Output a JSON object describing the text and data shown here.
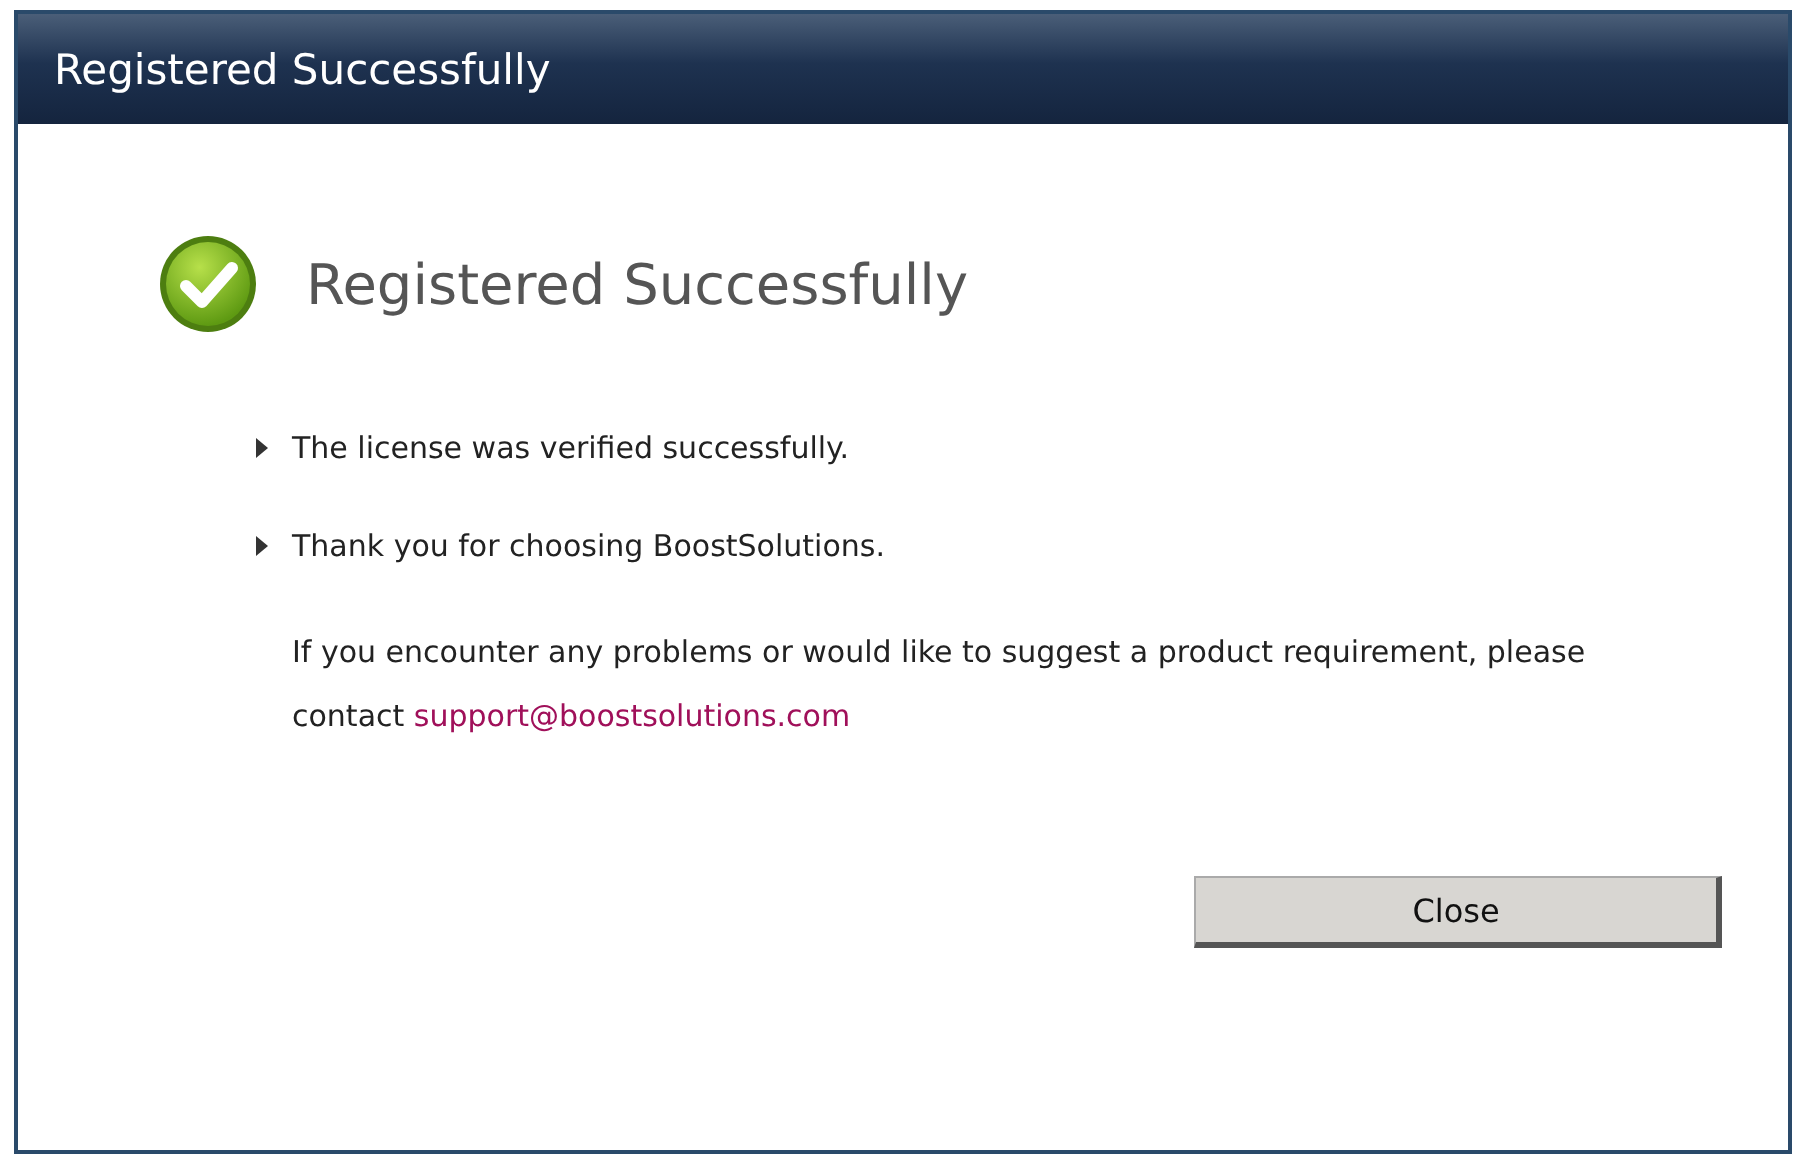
{
  "window": {
    "title": "Registered Successfully"
  },
  "heading": "Registered Successfully",
  "bullets": [
    "The license was verified successfully.",
    "Thank you for choosing BoostSolutions."
  ],
  "contact": {
    "text": "If you encounter any problems or would like to suggest a product requirement, please contact",
    "link": "support@boostsolutions.com"
  },
  "buttons": [
    "Close"
  ]
}
